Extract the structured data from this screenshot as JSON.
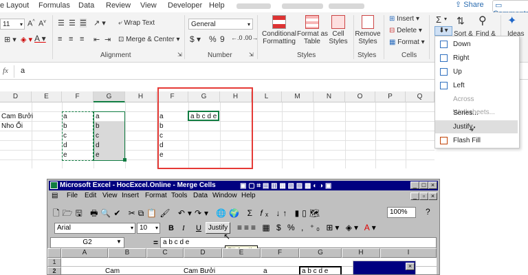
{
  "ribbon_tabs": [
    "e Layout",
    "Formulas",
    "Data",
    "Review",
    "View",
    "Developer",
    "Help"
  ],
  "share_label": "Share",
  "comments_label": "Comments",
  "font": {
    "size": "11"
  },
  "alignment": {
    "wrap_text": "Wrap Text",
    "merge_center": "Merge & Center",
    "group_label": "Alignment"
  },
  "number": {
    "format": "General",
    "percent": "%",
    "comma": "9",
    "group_label": "Number"
  },
  "styles": {
    "conditional": [
      "Conditional",
      "Formatting"
    ],
    "format_as": [
      "Format as",
      "Table"
    ],
    "cell_styles": [
      "Cell",
      "Styles"
    ],
    "group_label": "Styles"
  },
  "cells_group": {
    "insert": "Insert",
    "delete": "Delete",
    "format": "Format",
    "group_label": "Cells"
  },
  "editing": {
    "sum_sign": "Σ",
    "sort": "Sort &",
    "find": "Find &"
  },
  "ideas": "Ideas",
  "remove_styles": [
    "Remove",
    "Styles"
  ],
  "formula_bar": {
    "fx": "fx",
    "value": "a"
  },
  "sheet": {
    "col_headers": [
      "D",
      "E",
      "F",
      "G",
      "H",
      "F",
      "G",
      "H",
      "L",
      "M",
      "N",
      "O",
      "P",
      "Q"
    ],
    "d_col": [
      "Cam Bưởi",
      "Nho Ổi"
    ],
    "f_col": [
      "a",
      "b",
      "c",
      "d",
      "e"
    ],
    "g_col": [
      "a",
      "b",
      "c",
      "d",
      "e"
    ],
    "f2_col": [
      "a",
      "b",
      "c",
      "d",
      "e"
    ],
    "g2_merged": "a b c d e"
  },
  "fill_menu": {
    "items": [
      "Down",
      "Right",
      "Up",
      "Left",
      "Across Worksheets...",
      "Series...",
      "Justify",
      "Flash Fill"
    ],
    "disabled_index": 4,
    "highlighted_index": 6
  },
  "old_excel": {
    "title": "Microsoft Excel - HocExcel.Online - Merge Cells",
    "menu": [
      "File",
      "Edit",
      "View",
      "Insert",
      "Format",
      "Tools",
      "Data",
      "Window",
      "Help"
    ],
    "font_name": "Arial",
    "font_size": "10",
    "bold": "B",
    "italic": "I",
    "underline": "U",
    "justify_button": "Justify",
    "zoom": "100%",
    "name_box": "G2",
    "equals": "=",
    "formula": "a b c d e",
    "tooltip": "Fill Justify",
    "col_headers": [
      "A",
      "B",
      "C",
      "D",
      "E",
      "F",
      "G",
      "H",
      "I"
    ],
    "row_numbers": [
      "1",
      "2"
    ],
    "row2": [
      "Cam",
      "Cam Bưởi",
      "a",
      "a b c d e"
    ]
  },
  "colors": {
    "accent": "#107c41",
    "selection_red": "#e53935",
    "title_blue": "#000080"
  }
}
